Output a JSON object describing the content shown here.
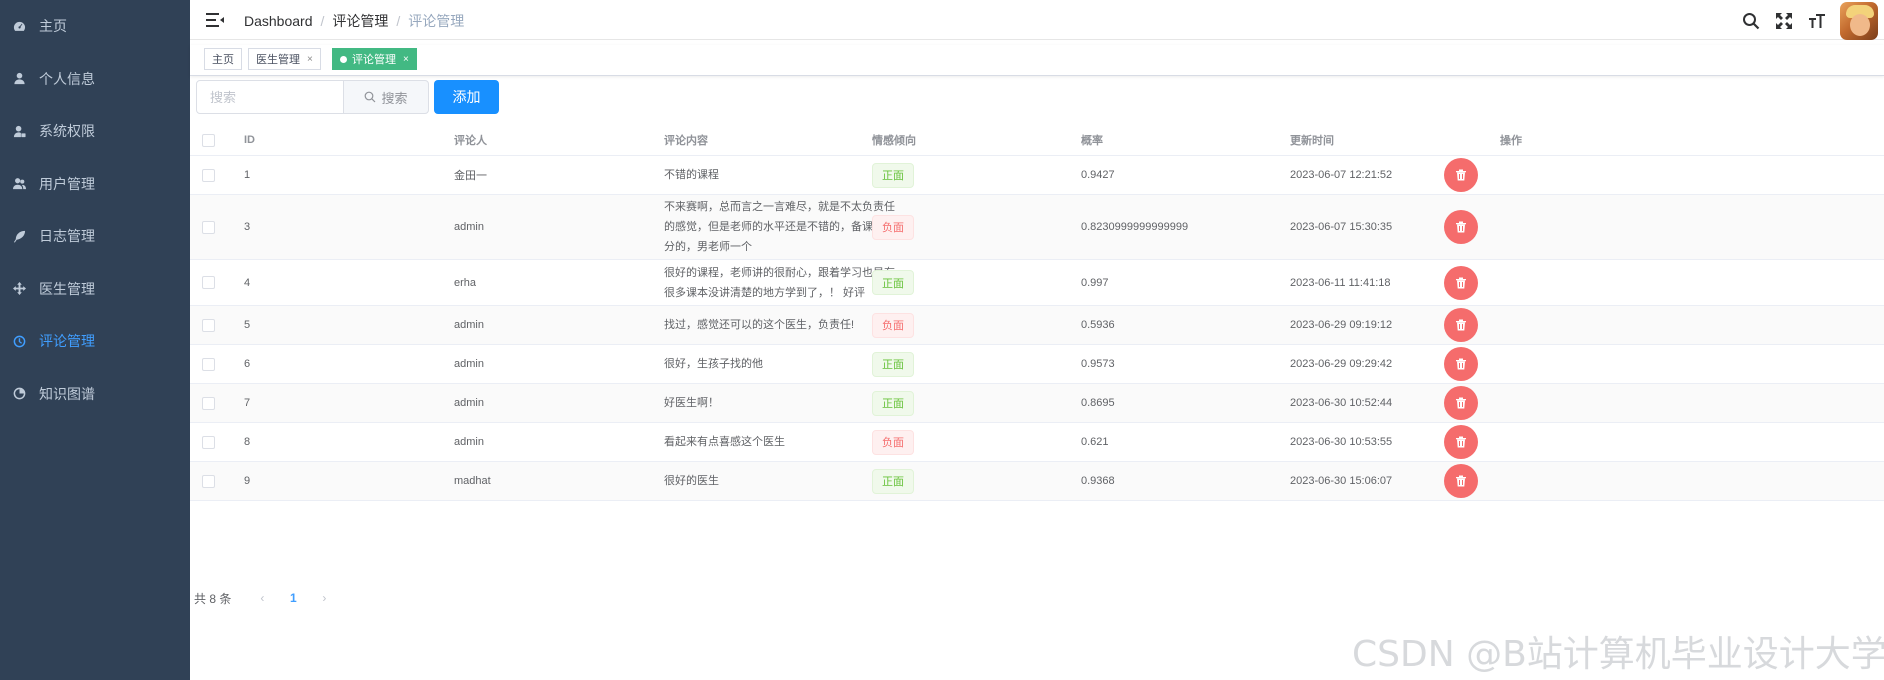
{
  "sidebar": {
    "items": [
      {
        "label": "主页",
        "icon": "dashboard-icon"
      },
      {
        "label": "个人信息",
        "icon": "user-icon"
      },
      {
        "label": "系统权限",
        "icon": "user-lock-icon"
      },
      {
        "label": "用户管理",
        "icon": "users-icon"
      },
      {
        "label": "日志管理",
        "icon": "feather-icon"
      },
      {
        "label": "医生管理",
        "icon": "arrows-icon"
      },
      {
        "label": "评论管理",
        "icon": "clock-icon",
        "active": true
      },
      {
        "label": "知识图谱",
        "icon": "chart-icon"
      }
    ]
  },
  "header": {
    "breadcrumb": [
      "Dashboard",
      "评论管理",
      "评论管理"
    ]
  },
  "tags": [
    {
      "label": "主页",
      "closable": false,
      "active": false
    },
    {
      "label": "医生管理",
      "closable": true,
      "active": false
    },
    {
      "label": "评论管理",
      "closable": true,
      "active": true
    }
  ],
  "toolbar": {
    "search_placeholder": "搜索",
    "search_label": "搜索",
    "add_label": "添加"
  },
  "table": {
    "columns": [
      "ID",
      "评论人",
      "评论内容",
      "情感倾向",
      "概率",
      "更新时间",
      "操作"
    ],
    "rows": [
      {
        "id": "1",
        "user": "金田一",
        "content": "不错的课程",
        "sentiment": "正面",
        "prob": "0.9427",
        "time": "2023-06-07 12:21:52"
      },
      {
        "id": "3",
        "user": "admin",
        "content": "不来赛啊，总而言之一言难尽，就是不太负责任的感觉，但是老师的水平还是不错的，备课挺充分的，男老师一个",
        "sentiment": "负面",
        "prob": "0.8230999999999999",
        "time": "2023-06-07 15:30:35"
      },
      {
        "id": "4",
        "user": "erha",
        "content": "很好的课程，老师讲的很耐心，跟着学习也是有很多课本没讲清楚的地方学到了，！ 好评",
        "sentiment": "正面",
        "prob": "0.997",
        "time": "2023-06-11 11:41:18"
      },
      {
        "id": "5",
        "user": "admin",
        "content": "找过，感觉还可以的这个医生，负责任!",
        "sentiment": "负面",
        "prob": "0.5936",
        "time": "2023-06-29 09:19:12"
      },
      {
        "id": "6",
        "user": "admin",
        "content": "很好，生孩子找的他",
        "sentiment": "正面",
        "prob": "0.9573",
        "time": "2023-06-29 09:29:42"
      },
      {
        "id": "7",
        "user": "admin",
        "content": "好医生啊！",
        "sentiment": "正面",
        "prob": "0.8695",
        "time": "2023-06-30 10:52:44"
      },
      {
        "id": "8",
        "user": "admin",
        "content": "看起来有点喜感这个医生",
        "sentiment": "负面",
        "prob": "0.621",
        "time": "2023-06-30 10:53:55"
      },
      {
        "id": "9",
        "user": "madhat",
        "content": "很好的医生",
        "sentiment": "正面",
        "prob": "0.9368",
        "time": "2023-06-30 15:06:07"
      }
    ]
  },
  "pagination": {
    "total_label": "共 8 条",
    "current_page": "1"
  },
  "watermark": "CSDN @B站计算机毕业设计大学",
  "colors": {
    "sidebar_bg": "#304156",
    "active_menu": "#409eff",
    "active_tag": "#42b983",
    "primary": "#1890ff",
    "danger": "#f56c6c",
    "positive": "#67c23a"
  }
}
